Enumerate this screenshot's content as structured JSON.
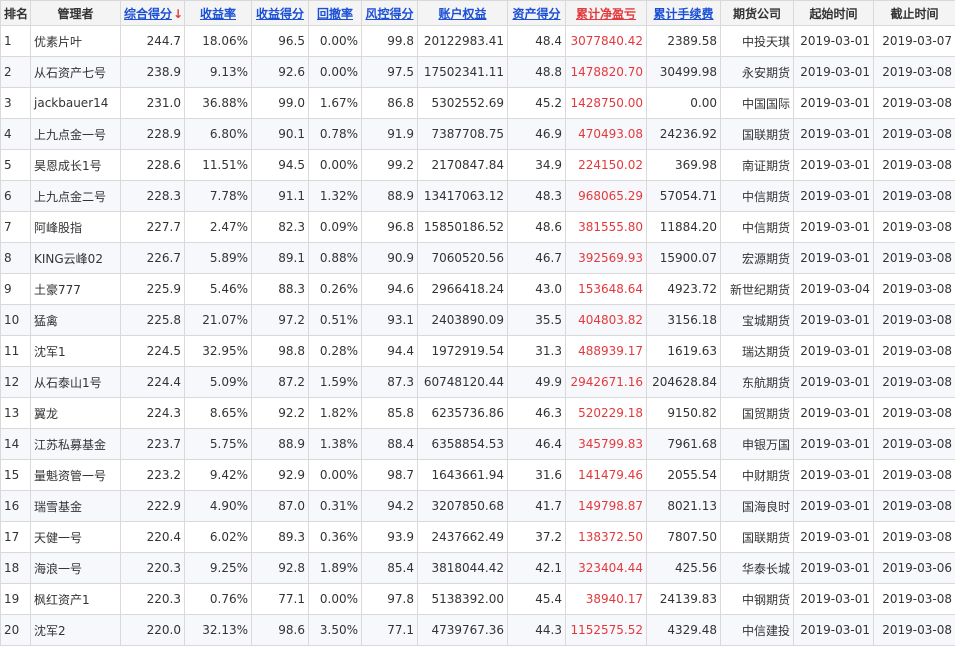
{
  "colors": {
    "link": "#1a4fd6",
    "loss_profit": "#e4393c",
    "header_bg": "#f4f4f4",
    "border": "#d9d9d9"
  },
  "header": {
    "rank": "排名",
    "manager": "管理者",
    "composite_score": "综合得分",
    "sort_icon": "↓",
    "return_rate": "收益率",
    "return_score": "收益得分",
    "drawdown": "回撤率",
    "risk_score": "风控得分",
    "equity": "账户权益",
    "asset_score": "资产得分",
    "cum_pnl": "累计净盈亏",
    "cum_fee": "累计手续费",
    "broker": "期货公司",
    "start": "起始时间",
    "end": "截止时间"
  },
  "rows": [
    {
      "rank": "1",
      "manager": "优素片叶",
      "composite": "244.7",
      "return_rate": "18.06%",
      "return_score": "96.5",
      "drawdown": "0.00%",
      "risk_score": "99.8",
      "equity": "20122983.41",
      "asset_score": "48.4",
      "cum_pnl": "3077840.42",
      "cum_fee": "2389.58",
      "broker": "中投天琪",
      "start": "2019-03-01",
      "end": "2019-03-07"
    },
    {
      "rank": "2",
      "manager": "从石资产七号",
      "composite": "238.9",
      "return_rate": "9.13%",
      "return_score": "92.6",
      "drawdown": "0.00%",
      "risk_score": "97.5",
      "equity": "17502341.11",
      "asset_score": "48.8",
      "cum_pnl": "1478820.70",
      "cum_fee": "30499.98",
      "broker": "永安期货",
      "start": "2019-03-01",
      "end": "2019-03-08"
    },
    {
      "rank": "3",
      "manager": "jackbauer14",
      "composite": "231.0",
      "return_rate": "36.88%",
      "return_score": "99.0",
      "drawdown": "1.67%",
      "risk_score": "86.8",
      "equity": "5302552.69",
      "asset_score": "45.2",
      "cum_pnl": "1428750.00",
      "cum_fee": "0.00",
      "broker": "中国国际",
      "start": "2019-03-01",
      "end": "2019-03-08"
    },
    {
      "rank": "4",
      "manager": "上九点金一号",
      "composite": "228.9",
      "return_rate": "6.80%",
      "return_score": "90.1",
      "drawdown": "0.78%",
      "risk_score": "91.9",
      "equity": "7387708.75",
      "asset_score": "46.9",
      "cum_pnl": "470493.08",
      "cum_fee": "24236.92",
      "broker": "国联期货",
      "start": "2019-03-01",
      "end": "2019-03-08"
    },
    {
      "rank": "5",
      "manager": "昊恩成长1号",
      "composite": "228.6",
      "return_rate": "11.51%",
      "return_score": "94.5",
      "drawdown": "0.00%",
      "risk_score": "99.2",
      "equity": "2170847.84",
      "asset_score": "34.9",
      "cum_pnl": "224150.02",
      "cum_fee": "369.98",
      "broker": "南证期货",
      "start": "2019-03-01",
      "end": "2019-03-08"
    },
    {
      "rank": "6",
      "manager": "上九点金二号",
      "composite": "228.3",
      "return_rate": "7.78%",
      "return_score": "91.1",
      "drawdown": "1.32%",
      "risk_score": "88.9",
      "equity": "13417063.12",
      "asset_score": "48.3",
      "cum_pnl": "968065.29",
      "cum_fee": "57054.71",
      "broker": "中信期货",
      "start": "2019-03-01",
      "end": "2019-03-08"
    },
    {
      "rank": "7",
      "manager": "阿峰股指",
      "composite": "227.7",
      "return_rate": "2.47%",
      "return_score": "82.3",
      "drawdown": "0.09%",
      "risk_score": "96.8",
      "equity": "15850186.52",
      "asset_score": "48.6",
      "cum_pnl": "381555.80",
      "cum_fee": "11884.20",
      "broker": "中信期货",
      "start": "2019-03-01",
      "end": "2019-03-08"
    },
    {
      "rank": "8",
      "manager": "KING云峰02",
      "composite": "226.7",
      "return_rate": "5.89%",
      "return_score": "89.1",
      "drawdown": "0.88%",
      "risk_score": "90.9",
      "equity": "7060520.56",
      "asset_score": "46.7",
      "cum_pnl": "392569.93",
      "cum_fee": "15900.07",
      "broker": "宏源期货",
      "start": "2019-03-01",
      "end": "2019-03-08"
    },
    {
      "rank": "9",
      "manager": "土豪777",
      "composite": "225.9",
      "return_rate": "5.46%",
      "return_score": "88.3",
      "drawdown": "0.26%",
      "risk_score": "94.6",
      "equity": "2966418.24",
      "asset_score": "43.0",
      "cum_pnl": "153648.64",
      "cum_fee": "4923.72",
      "broker": "新世纪期货",
      "start": "2019-03-04",
      "end": "2019-03-08"
    },
    {
      "rank": "10",
      "manager": "猛禽",
      "composite": "225.8",
      "return_rate": "21.07%",
      "return_score": "97.2",
      "drawdown": "0.51%",
      "risk_score": "93.1",
      "equity": "2403890.09",
      "asset_score": "35.5",
      "cum_pnl": "404803.82",
      "cum_fee": "3156.18",
      "broker": "宝城期货",
      "start": "2019-03-01",
      "end": "2019-03-08"
    },
    {
      "rank": "11",
      "manager": "沈军1",
      "composite": "224.5",
      "return_rate": "32.95%",
      "return_score": "98.8",
      "drawdown": "0.28%",
      "risk_score": "94.4",
      "equity": "1972919.54",
      "asset_score": "31.3",
      "cum_pnl": "488939.17",
      "cum_fee": "1619.63",
      "broker": "瑞达期货",
      "start": "2019-03-01",
      "end": "2019-03-08"
    },
    {
      "rank": "12",
      "manager": "从石泰山1号",
      "composite": "224.4",
      "return_rate": "5.09%",
      "return_score": "87.2",
      "drawdown": "1.59%",
      "risk_score": "87.3",
      "equity": "60748120.44",
      "asset_score": "49.9",
      "cum_pnl": "2942671.16",
      "cum_fee": "204628.84",
      "broker": "东航期货",
      "start": "2019-03-01",
      "end": "2019-03-08"
    },
    {
      "rank": "13",
      "manager": "翼龙",
      "composite": "224.3",
      "return_rate": "8.65%",
      "return_score": "92.2",
      "drawdown": "1.82%",
      "risk_score": "85.8",
      "equity": "6235736.86",
      "asset_score": "46.3",
      "cum_pnl": "520229.18",
      "cum_fee": "9150.82",
      "broker": "国贸期货",
      "start": "2019-03-01",
      "end": "2019-03-08"
    },
    {
      "rank": "14",
      "manager": "江苏私募基金",
      "composite": "223.7",
      "return_rate": "5.75%",
      "return_score": "88.9",
      "drawdown": "1.38%",
      "risk_score": "88.4",
      "equity": "6358854.53",
      "asset_score": "46.4",
      "cum_pnl": "345799.83",
      "cum_fee": "7961.68",
      "broker": "申银万国",
      "start": "2019-03-01",
      "end": "2019-03-08"
    },
    {
      "rank": "15",
      "manager": "量魁资管一号",
      "composite": "223.2",
      "return_rate": "9.42%",
      "return_score": "92.9",
      "drawdown": "0.00%",
      "risk_score": "98.7",
      "equity": "1643661.94",
      "asset_score": "31.6",
      "cum_pnl": "141479.46",
      "cum_fee": "2055.54",
      "broker": "中财期货",
      "start": "2019-03-01",
      "end": "2019-03-08"
    },
    {
      "rank": "16",
      "manager": "瑞雪基金",
      "composite": "222.9",
      "return_rate": "4.90%",
      "return_score": "87.0",
      "drawdown": "0.31%",
      "risk_score": "94.2",
      "equity": "3207850.68",
      "asset_score": "41.7",
      "cum_pnl": "149798.87",
      "cum_fee": "8021.13",
      "broker": "国海良时",
      "start": "2019-03-01",
      "end": "2019-03-08"
    },
    {
      "rank": "17",
      "manager": "天健一号",
      "composite": "220.4",
      "return_rate": "6.02%",
      "return_score": "89.3",
      "drawdown": "0.36%",
      "risk_score": "93.9",
      "equity": "2437662.49",
      "asset_score": "37.2",
      "cum_pnl": "138372.50",
      "cum_fee": "7807.50",
      "broker": "国联期货",
      "start": "2019-03-01",
      "end": "2019-03-08"
    },
    {
      "rank": "18",
      "manager": "海浪一号",
      "composite": "220.3",
      "return_rate": "9.25%",
      "return_score": "92.8",
      "drawdown": "1.89%",
      "risk_score": "85.4",
      "equity": "3818044.42",
      "asset_score": "42.1",
      "cum_pnl": "323404.44",
      "cum_fee": "425.56",
      "broker": "华泰长城",
      "start": "2019-03-01",
      "end": "2019-03-06"
    },
    {
      "rank": "19",
      "manager": "枫红资产1",
      "composite": "220.3",
      "return_rate": "0.76%",
      "return_score": "77.1",
      "drawdown": "0.00%",
      "risk_score": "97.8",
      "equity": "5138392.00",
      "asset_score": "45.4",
      "cum_pnl": "38940.17",
      "cum_fee": "24139.83",
      "broker": "中钢期货",
      "start": "2019-03-01",
      "end": "2019-03-08"
    },
    {
      "rank": "20",
      "manager": "沈军2",
      "composite": "220.0",
      "return_rate": "32.13%",
      "return_score": "98.6",
      "drawdown": "3.50%",
      "risk_score": "77.1",
      "equity": "4739767.36",
      "asset_score": "44.3",
      "cum_pnl": "1152575.52",
      "cum_fee": "4329.48",
      "broker": "中信建投",
      "start": "2019-03-01",
      "end": "2019-03-08"
    }
  ]
}
